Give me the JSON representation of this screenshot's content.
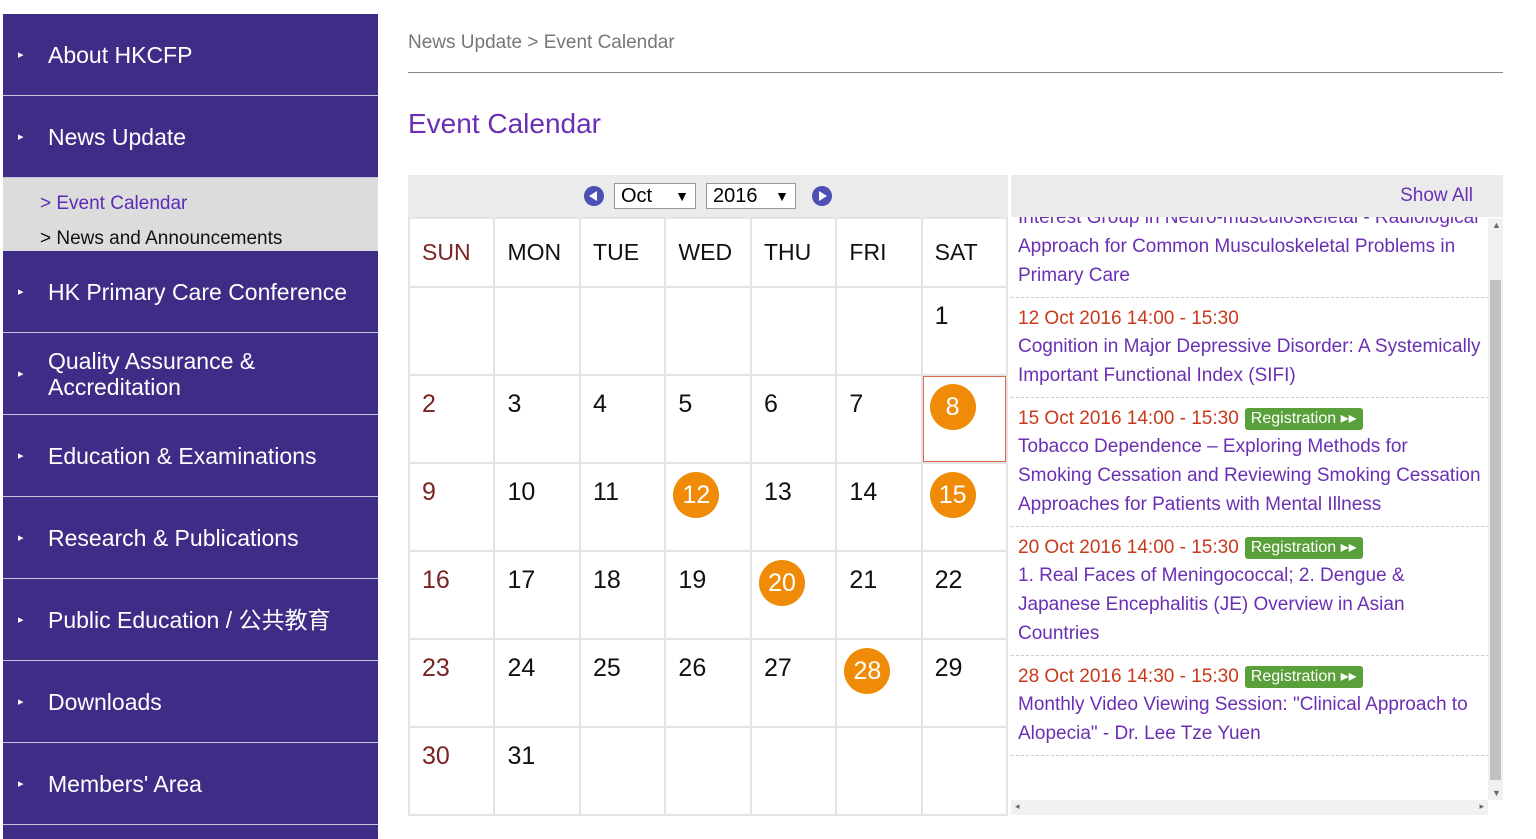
{
  "sidebar": {
    "items": [
      {
        "label": "About HKCFP"
      },
      {
        "label": "News Update"
      },
      {
        "label": "HK Primary Care Conference"
      },
      {
        "label": "Quality Assurance & Accreditation"
      },
      {
        "label": "Education & Examinations"
      },
      {
        "label": "Research & Publications"
      },
      {
        "label": "Public Education / 公共教育"
      },
      {
        "label": "Downloads"
      },
      {
        "label": "Members' Area"
      }
    ],
    "subitems": [
      {
        "label": "> Event Calendar",
        "active": true
      },
      {
        "label": "> News and Announcements",
        "active": false
      }
    ],
    "arrow": "▸"
  },
  "breadcrumb": "News Update > Event Calendar",
  "page_title": "Event Calendar",
  "calendar": {
    "month": "Oct",
    "year": "2016",
    "weekdays": [
      "SUN",
      "MON",
      "TUE",
      "WED",
      "THU",
      "FRI",
      "SAT"
    ],
    "weeks": [
      [
        "",
        "",
        "",
        "",
        "",
        "",
        "1"
      ],
      [
        "2",
        "3",
        "4",
        "5",
        "6",
        "7",
        "8"
      ],
      [
        "9",
        "10",
        "11",
        "12",
        "13",
        "14",
        "15"
      ],
      [
        "16",
        "17",
        "18",
        "19",
        "20",
        "21",
        "22"
      ],
      [
        "23",
        "24",
        "25",
        "26",
        "27",
        "28",
        "29"
      ],
      [
        "30",
        "31",
        "",
        "",
        "",
        "",
        ""
      ]
    ],
    "event_days": [
      "8",
      "12",
      "15",
      "20",
      "28"
    ],
    "today": "8",
    "colors": {
      "event": "#f08b07",
      "sunday": "#7a2323",
      "nav": "#3f2c87",
      "accent": "#6a2fb3"
    }
  },
  "events": {
    "show_all": "Show All",
    "registration_label": "Registration ▸▸",
    "items": [
      {
        "date": "",
        "title": "Interest Group in Neuro-musculoskeletal - Radiological Approach for Common Musculoskeletal Problems in Primary Care",
        "registration": false
      },
      {
        "date": "12 Oct 2016 14:00 - 15:30",
        "title": "Cognition in Major Depressive Disorder: A Systemically Important Functional Index (SIFI)",
        "registration": false
      },
      {
        "date": "15 Oct 2016 14:00 - 15:30",
        "title": "Tobacco Dependence – Exploring Methods for Smoking Cessation and Reviewing Smoking Cessation Approaches for Patients with Mental Illness",
        "registration": true
      },
      {
        "date": "20 Oct 2016 14:00 - 15:30",
        "title": "1. Real Faces of Meningococcal; 2. Dengue & Japanese Encephalitis (JE) Overview in Asian Countries",
        "registration": true
      },
      {
        "date": "28 Oct 2016 14:30 - 15:30",
        "title": "Monthly Video Viewing Session: \"Clinical Approach to Alopecia\" - Dr. Lee Tze Yuen",
        "registration": true
      }
    ]
  }
}
